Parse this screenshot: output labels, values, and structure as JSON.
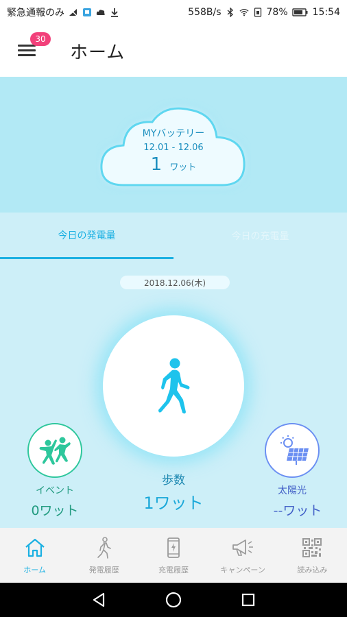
{
  "status_bar": {
    "left_text": "緊急通報のみ",
    "speed": "558B/s",
    "battery_percent": "78%",
    "time": "15:54"
  },
  "app_bar": {
    "title": "ホーム",
    "notification_count": "30"
  },
  "cloud": {
    "title": "MYバッテリー",
    "date_range": "12.01 - 12.06",
    "value": "1",
    "unit": "ワット"
  },
  "tabs": [
    {
      "label": "今日の発電量",
      "active": true
    },
    {
      "label": "今日の充電量",
      "active": false
    }
  ],
  "date": "2018.12.06(木)",
  "generation": {
    "event": {
      "label": "イベント",
      "value": "0ワット"
    },
    "steps": {
      "label": "歩数",
      "value": "1ワット"
    },
    "solar": {
      "label": "太陽光",
      "value": "--ワット"
    }
  },
  "bottom_nav": [
    {
      "label": "ホーム",
      "icon": "home-icon",
      "active": true
    },
    {
      "label": "発電履歴",
      "icon": "walking-icon",
      "active": false
    },
    {
      "label": "充電履歴",
      "icon": "phone-charge-icon",
      "active": false
    },
    {
      "label": "キャンペーン",
      "icon": "megaphone-icon",
      "active": false
    },
    {
      "label": "読み込み",
      "icon": "qr-code-icon",
      "active": false
    }
  ],
  "colors": {
    "accent": "#1ab0e2",
    "hero_bg": "#b2e9f5",
    "main_bg": "#cdeff8",
    "event": "#2ec79c",
    "solar": "#6b8ff2",
    "badge": "#f2407a"
  }
}
